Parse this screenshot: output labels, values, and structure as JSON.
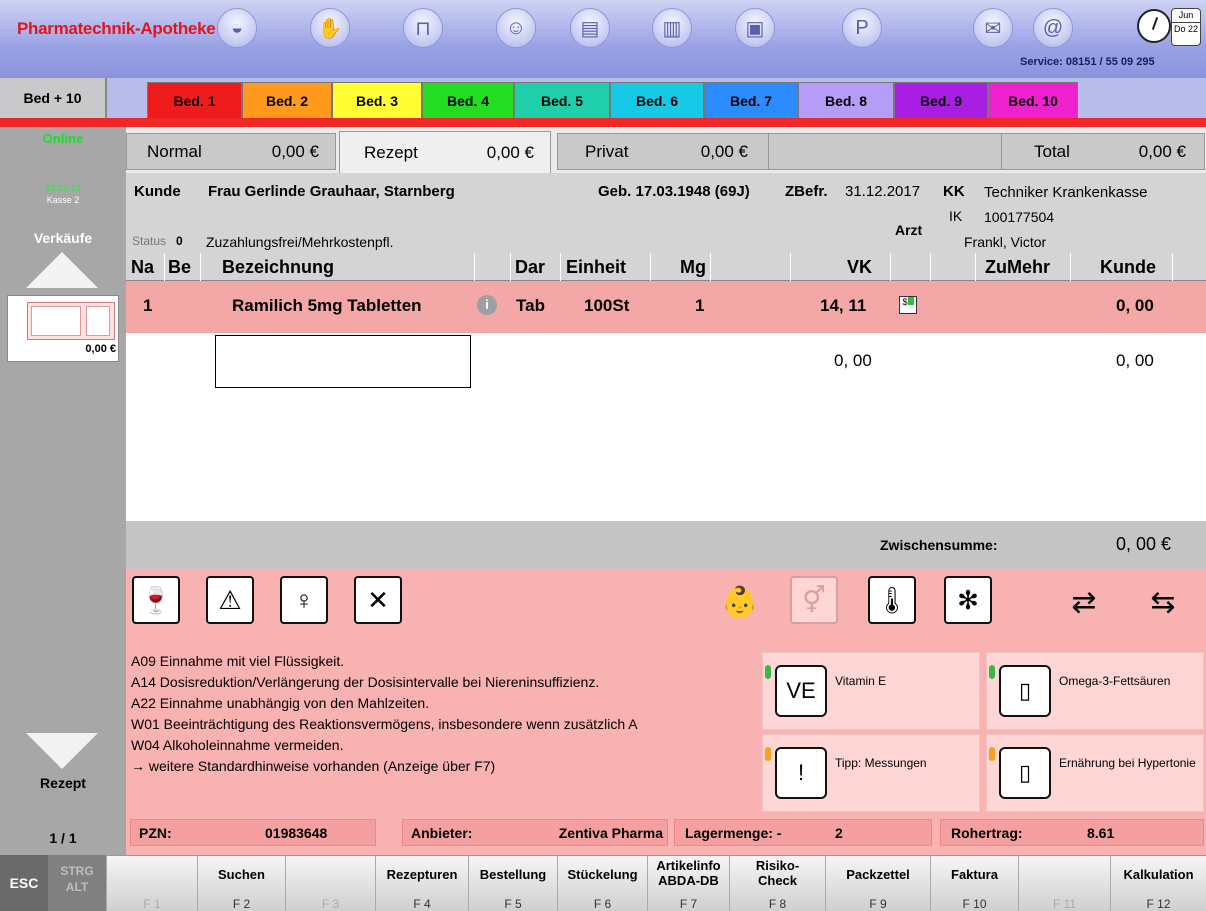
{
  "app": {
    "title": "Pharmatechnik-Apotheke",
    "service": "Service: 08151 / 55 09 295",
    "calendar": {
      "month": "Jun",
      "day": "Do 22"
    }
  },
  "tabs": {
    "bed_plus": "Bed + 10",
    "items": [
      {
        "label": "Bed. 1",
        "color": "#f01c1c"
      },
      {
        "label": "Bed. 2",
        "color": "#ff9a1e"
      },
      {
        "label": "Bed. 3",
        "color": "#ffff33"
      },
      {
        "label": "Bed. 4",
        "color": "#22dd22"
      },
      {
        "label": "Bed. 5",
        "color": "#1ecfaa"
      },
      {
        "label": "Bed. 6",
        "color": "#16c9e6"
      },
      {
        "label": "Bed. 7",
        "color": "#2a8cff"
      },
      {
        "label": "Bed. 8",
        "color": "#b59cf6"
      },
      {
        "label": "Bed. 9",
        "color": "#a81ee3"
      },
      {
        "label": "Bed. 10",
        "color": "#ee22cc"
      }
    ]
  },
  "left": {
    "online": "Online",
    "time": "12:33:18",
    "kasse": "Kasse 2",
    "verkaeufe": "Verkäufe",
    "cart_amount": "0,00 €",
    "mode": "Rezept",
    "page": "1 / 1"
  },
  "totals": {
    "normal_label": "Normal",
    "normal_value": "0,00 €",
    "rezept_label": "Rezept",
    "rezept_value": "0,00 €",
    "privat_label": "Privat",
    "privat_value": "0,00 €",
    "total_label": "Total",
    "total_value": "0,00 €"
  },
  "customer": {
    "kunde_label": "Kunde",
    "kunde_value": "Frau Gerlinde Grauhaar, Starnberg",
    "geb": "Geb. 17.03.1948 (69J)",
    "zbefr_label": "ZBefr.",
    "zbefr_value": "31.12.2017",
    "kk_label": "KK",
    "kk_value": "Techniker Krankenkasse",
    "ik_label": "IK",
    "ik_value": "100177504",
    "arzt_label": "Arzt",
    "arzt_value": "Frankl, Victor",
    "status_label": "Status",
    "status_value": "0",
    "status_text": "Zuzahlungsfrei/Mehrkostenpfl."
  },
  "table": {
    "headers": {
      "na": "Na",
      "be": "Be",
      "bezeichnung": "Bezeichnung",
      "dar": "Dar",
      "einheit": "Einheit",
      "mg": "Mg",
      "vk": "VK",
      "zumehr": "ZuMehr",
      "kunde": "Kunde"
    },
    "row": {
      "na": "1",
      "bezeichnung": "Ramilich 5mg Tabletten",
      "dar": "Tab",
      "einheit": "100St",
      "mg": "1",
      "vk": "14, 11",
      "kunde": "0, 00"
    },
    "entry": {
      "vk": "0, 00",
      "kunde": "0, 00"
    }
  },
  "subtotal": {
    "label": "Zwischensumme:",
    "value": "0, 00 €"
  },
  "hints": [
    "A09 Einnahme mit viel Flüssigkeit.",
    "A14 Dosisreduktion/Verlängerung der Dosisintervalle bei Niereninsuffizienz.",
    "A22 Einnahme unabhängig von den Mahlzeiten.",
    "W01 Beeinträchtigung des Reaktionsvermögens, insbesondere wenn zusätzlich A",
    "W04 Alkoholeinnahme vermeiden.",
    "→ weitere Standardhinweise vorhanden (Anzeige über F7)"
  ],
  "cards": [
    {
      "label": "Vitamin E",
      "dot": "#39b54a"
    },
    {
      "label": "Omega-3-Fettsäuren",
      "dot": "#39b54a"
    },
    {
      "label": "Tipp: Messungen",
      "dot": "#f7a21b"
    },
    {
      "label": "Ernährung bei Hypertonie",
      "dot": "#f7a21b"
    }
  ],
  "info": {
    "pzn_label": "PZN:",
    "pzn_value": "01983648",
    "anbieter_label": "Anbieter:",
    "anbieter_value": "Zentiva Pharma",
    "lager_label": "Lagermenge: -",
    "lager_value": "2",
    "rohertrag_label": "Rohertrag:",
    "rohertrag_value": "8.61"
  },
  "fkeys": {
    "esc": "ESC",
    "strg": "STRG",
    "alt": "ALT",
    "keys": [
      {
        "label": "",
        "key": "F 1"
      },
      {
        "label": "Suchen",
        "key": "F 2"
      },
      {
        "label": "",
        "key": "F 3"
      },
      {
        "label": "Rezepturen",
        "key": "F 4"
      },
      {
        "label": "Bestellung",
        "key": "F 5"
      },
      {
        "label": "Stückelung",
        "key": "F 6"
      },
      {
        "label": "Artikelinfo ABDA-DB",
        "key": "F 7"
      },
      {
        "label": "Risiko-Check",
        "key": "F 8"
      },
      {
        "label": "Packzettel",
        "key": "F 9"
      },
      {
        "label": "Faktura",
        "key": "F 10"
      },
      {
        "label": "",
        "key": "F 11"
      },
      {
        "label": "Kalkulation",
        "key": "F 12"
      }
    ]
  }
}
